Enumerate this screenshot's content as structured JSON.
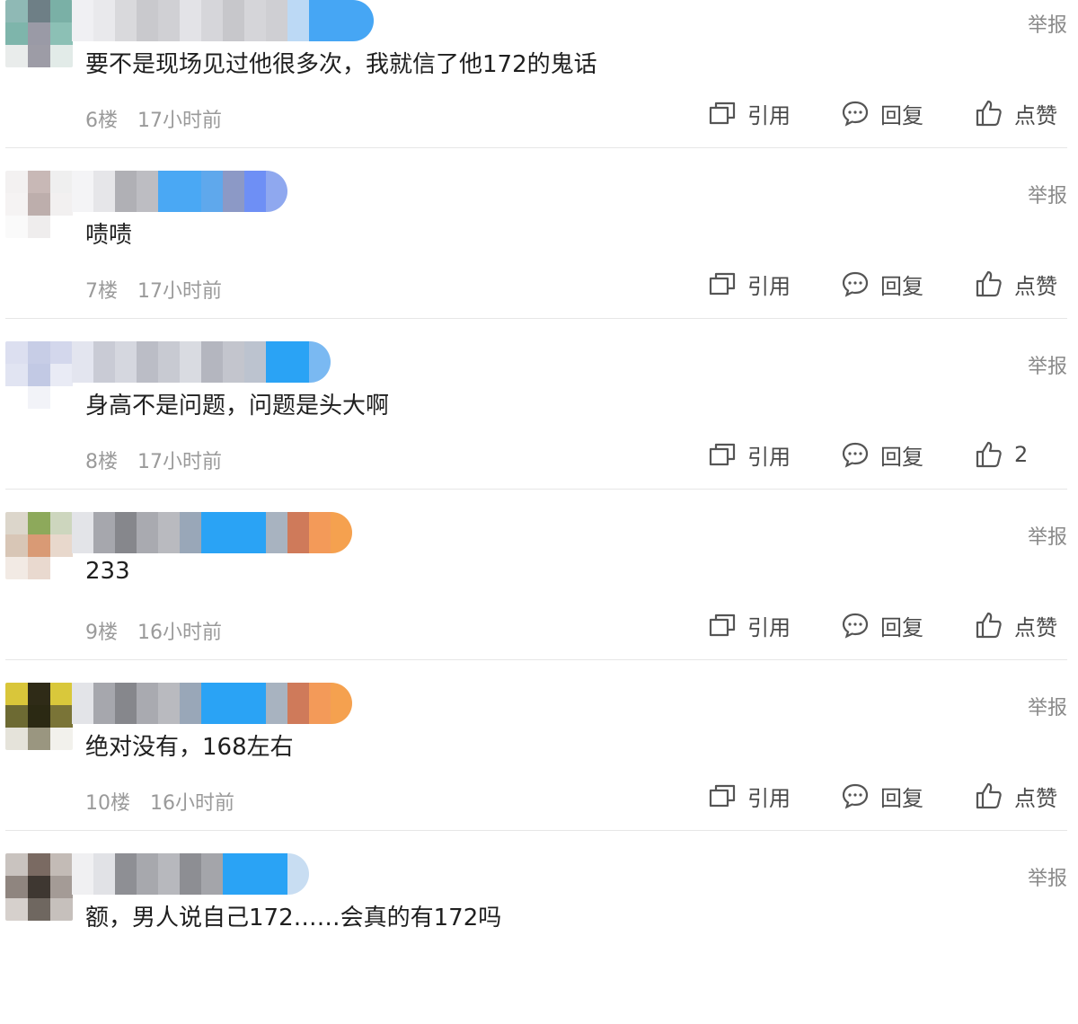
{
  "actions": {
    "quote_label": "引用",
    "reply_label": "回复",
    "report_label": "举报"
  },
  "comments": [
    {
      "floor": "6楼",
      "time": "17小时前",
      "text": "要不是现场见过他很多次，我就信了他172的鬼话",
      "like": "点赞",
      "avatar": [
        "#8fb9b5",
        "#6e7f86",
        "#7ab0a6",
        "#7eb5ab",
        "#9a9aa6",
        "#8cc0b5",
        "#e9eceb",
        "#9d9ca6",
        "#e2ebe8"
      ],
      "name": [
        "#f0f0f3",
        "#e9e9ec",
        "#d9d9dc",
        "#c9c9cd",
        "#d0d0d4",
        "#e3e3e7",
        "#d6d6da",
        "#c7c7cb",
        "#d5d5d9",
        "#cfcfd3",
        "#bcd9f5",
        "#46a6f4",
        "#46a6f4",
        "#46a6f4"
      ]
    },
    {
      "floor": "7楼",
      "time": "17小时前",
      "text": "啧啧",
      "like": "点赞",
      "avatar": [
        "#f3f1f1",
        "#c8b8b6",
        "#efefef",
        "#f5f3f3",
        "#bdaeac",
        "#f2f0f0",
        "#fafafa",
        "#efeded",
        "#ffffff"
      ],
      "name": [
        "#f4f4f6",
        "#e6e6e9",
        "#b0b0b5",
        "#bdbdc2",
        "#4aa8f4",
        "#4aa8f4",
        "#5fa8ec",
        "#8c99c6",
        "#6e8ff5",
        "#8fa8ef"
      ]
    },
    {
      "floor": "8楼",
      "time": "17小时前",
      "text": "身高不是问题，问题是头大啊",
      "like": "2",
      "avatar": [
        "#dcdff0",
        "#c7cde6",
        "#d3d7ec",
        "#e1e4f2",
        "#c2c9e4",
        "#e9ebf5",
        "#ffffff",
        "#f2f3f8",
        "#ffffff"
      ],
      "name": [
        "#e3e5ef",
        "#c9cbd5",
        "#d5d7df",
        "#bbbdc6",
        "#c8cad2",
        "#d9dbe1",
        "#b4b6bf",
        "#c3c5cd",
        "#bcc3cf",
        "#2aa3f5",
        "#2aa3f5",
        "#7ab9f2"
      ]
    },
    {
      "floor": "9楼",
      "time": "16小时前",
      "text": "233",
      "like": "点赞",
      "avatar": [
        "#dcd6cb",
        "#8da95b",
        "#cdd6be",
        "#d8c6b6",
        "#d99a75",
        "#e8d8cc",
        "#f2eae4",
        "#e9d9cf",
        "#ffffff"
      ],
      "name": [
        "#e3e4e8",
        "#a6a7ad",
        "#86878c",
        "#a9aab0",
        "#b9babf",
        "#99a7b8",
        "#2aa3f5",
        "#2aa3f5",
        "#2aa3f5",
        "#a8b3c0",
        "#cf7a5a",
        "#f39a59",
        "#f5a14f"
      ]
    },
    {
      "floor": "10楼",
      "time": "16小时前",
      "text": "绝对没有，168左右",
      "like": "点赞",
      "avatar": [
        "#d9c63a",
        "#2f2b17",
        "#d9c83b",
        "#6d6a33",
        "#2b2913",
        "#7a7437",
        "#e5e3da",
        "#9a9680",
        "#f2f1ec"
      ],
      "name": [
        "#e3e4e8",
        "#a6a7ad",
        "#86878c",
        "#a9aab0",
        "#b9babf",
        "#99a7b8",
        "#2aa3f5",
        "#2aa3f5",
        "#2aa3f5",
        "#a8b3c0",
        "#cf7a5a",
        "#f39a59",
        "#f5a14f"
      ]
    },
    {
      "floor": "",
      "time": "",
      "text": "额，男人说自己172……会真的有172吗",
      "like": "",
      "avatar": [
        "#c9c3bf",
        "#7a6a62",
        "#c3bbb6",
        "#8f857f",
        "#3e3731",
        "#a49b96",
        "#d6d0cc",
        "#6f6760",
        "#c6c0bc"
      ],
      "name": [
        "#f0f0f2",
        "#e1e2e6",
        "#8e8f94",
        "#a7a8ad",
        "#b7b8bd",
        "#8d8e93",
        "#a4a5aa",
        "#2aa3f5",
        "#2aa3f5",
        "#2aa3f5",
        "#c8ddf2"
      ]
    }
  ]
}
